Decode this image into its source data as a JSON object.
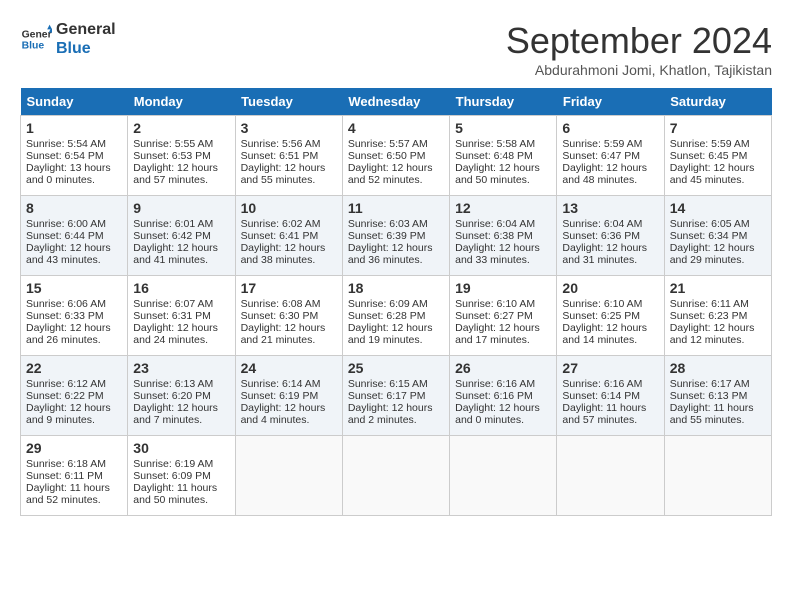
{
  "header": {
    "logo_line1": "General",
    "logo_line2": "Blue",
    "month": "September 2024",
    "location": "Abdurahmoni Jomi, Khatlon, Tajikistan"
  },
  "days_of_week": [
    "Sunday",
    "Monday",
    "Tuesday",
    "Wednesday",
    "Thursday",
    "Friday",
    "Saturday"
  ],
  "weeks": [
    [
      {
        "day": 1,
        "sunrise": "5:54 AM",
        "sunset": "6:54 PM",
        "daylight": "13 hours and 0 minutes."
      },
      {
        "day": 2,
        "sunrise": "5:55 AM",
        "sunset": "6:53 PM",
        "daylight": "12 hours and 57 minutes."
      },
      {
        "day": 3,
        "sunrise": "5:56 AM",
        "sunset": "6:51 PM",
        "daylight": "12 hours and 55 minutes."
      },
      {
        "day": 4,
        "sunrise": "5:57 AM",
        "sunset": "6:50 PM",
        "daylight": "12 hours and 52 minutes."
      },
      {
        "day": 5,
        "sunrise": "5:58 AM",
        "sunset": "6:48 PM",
        "daylight": "12 hours and 50 minutes."
      },
      {
        "day": 6,
        "sunrise": "5:59 AM",
        "sunset": "6:47 PM",
        "daylight": "12 hours and 48 minutes."
      },
      {
        "day": 7,
        "sunrise": "5:59 AM",
        "sunset": "6:45 PM",
        "daylight": "12 hours and 45 minutes."
      }
    ],
    [
      {
        "day": 8,
        "sunrise": "6:00 AM",
        "sunset": "6:44 PM",
        "daylight": "12 hours and 43 minutes."
      },
      {
        "day": 9,
        "sunrise": "6:01 AM",
        "sunset": "6:42 PM",
        "daylight": "12 hours and 41 minutes."
      },
      {
        "day": 10,
        "sunrise": "6:02 AM",
        "sunset": "6:41 PM",
        "daylight": "12 hours and 38 minutes."
      },
      {
        "day": 11,
        "sunrise": "6:03 AM",
        "sunset": "6:39 PM",
        "daylight": "12 hours and 36 minutes."
      },
      {
        "day": 12,
        "sunrise": "6:04 AM",
        "sunset": "6:38 PM",
        "daylight": "12 hours and 33 minutes."
      },
      {
        "day": 13,
        "sunrise": "6:04 AM",
        "sunset": "6:36 PM",
        "daylight": "12 hours and 31 minutes."
      },
      {
        "day": 14,
        "sunrise": "6:05 AM",
        "sunset": "6:34 PM",
        "daylight": "12 hours and 29 minutes."
      }
    ],
    [
      {
        "day": 15,
        "sunrise": "6:06 AM",
        "sunset": "6:33 PM",
        "daylight": "12 hours and 26 minutes."
      },
      {
        "day": 16,
        "sunrise": "6:07 AM",
        "sunset": "6:31 PM",
        "daylight": "12 hours and 24 minutes."
      },
      {
        "day": 17,
        "sunrise": "6:08 AM",
        "sunset": "6:30 PM",
        "daylight": "12 hours and 21 minutes."
      },
      {
        "day": 18,
        "sunrise": "6:09 AM",
        "sunset": "6:28 PM",
        "daylight": "12 hours and 19 minutes."
      },
      {
        "day": 19,
        "sunrise": "6:10 AM",
        "sunset": "6:27 PM",
        "daylight": "12 hours and 17 minutes."
      },
      {
        "day": 20,
        "sunrise": "6:10 AM",
        "sunset": "6:25 PM",
        "daylight": "12 hours and 14 minutes."
      },
      {
        "day": 21,
        "sunrise": "6:11 AM",
        "sunset": "6:23 PM",
        "daylight": "12 hours and 12 minutes."
      }
    ],
    [
      {
        "day": 22,
        "sunrise": "6:12 AM",
        "sunset": "6:22 PM",
        "daylight": "12 hours and 9 minutes."
      },
      {
        "day": 23,
        "sunrise": "6:13 AM",
        "sunset": "6:20 PM",
        "daylight": "12 hours and 7 minutes."
      },
      {
        "day": 24,
        "sunrise": "6:14 AM",
        "sunset": "6:19 PM",
        "daylight": "12 hours and 4 minutes."
      },
      {
        "day": 25,
        "sunrise": "6:15 AM",
        "sunset": "6:17 PM",
        "daylight": "12 hours and 2 minutes."
      },
      {
        "day": 26,
        "sunrise": "6:16 AM",
        "sunset": "6:16 PM",
        "daylight": "12 hours and 0 minutes."
      },
      {
        "day": 27,
        "sunrise": "6:16 AM",
        "sunset": "6:14 PM",
        "daylight": "11 hours and 57 minutes."
      },
      {
        "day": 28,
        "sunrise": "6:17 AM",
        "sunset": "6:13 PM",
        "daylight": "11 hours and 55 minutes."
      }
    ],
    [
      {
        "day": 29,
        "sunrise": "6:18 AM",
        "sunset": "6:11 PM",
        "daylight": "11 hours and 52 minutes."
      },
      {
        "day": 30,
        "sunrise": "6:19 AM",
        "sunset": "6:09 PM",
        "daylight": "11 hours and 50 minutes."
      },
      null,
      null,
      null,
      null,
      null
    ]
  ]
}
